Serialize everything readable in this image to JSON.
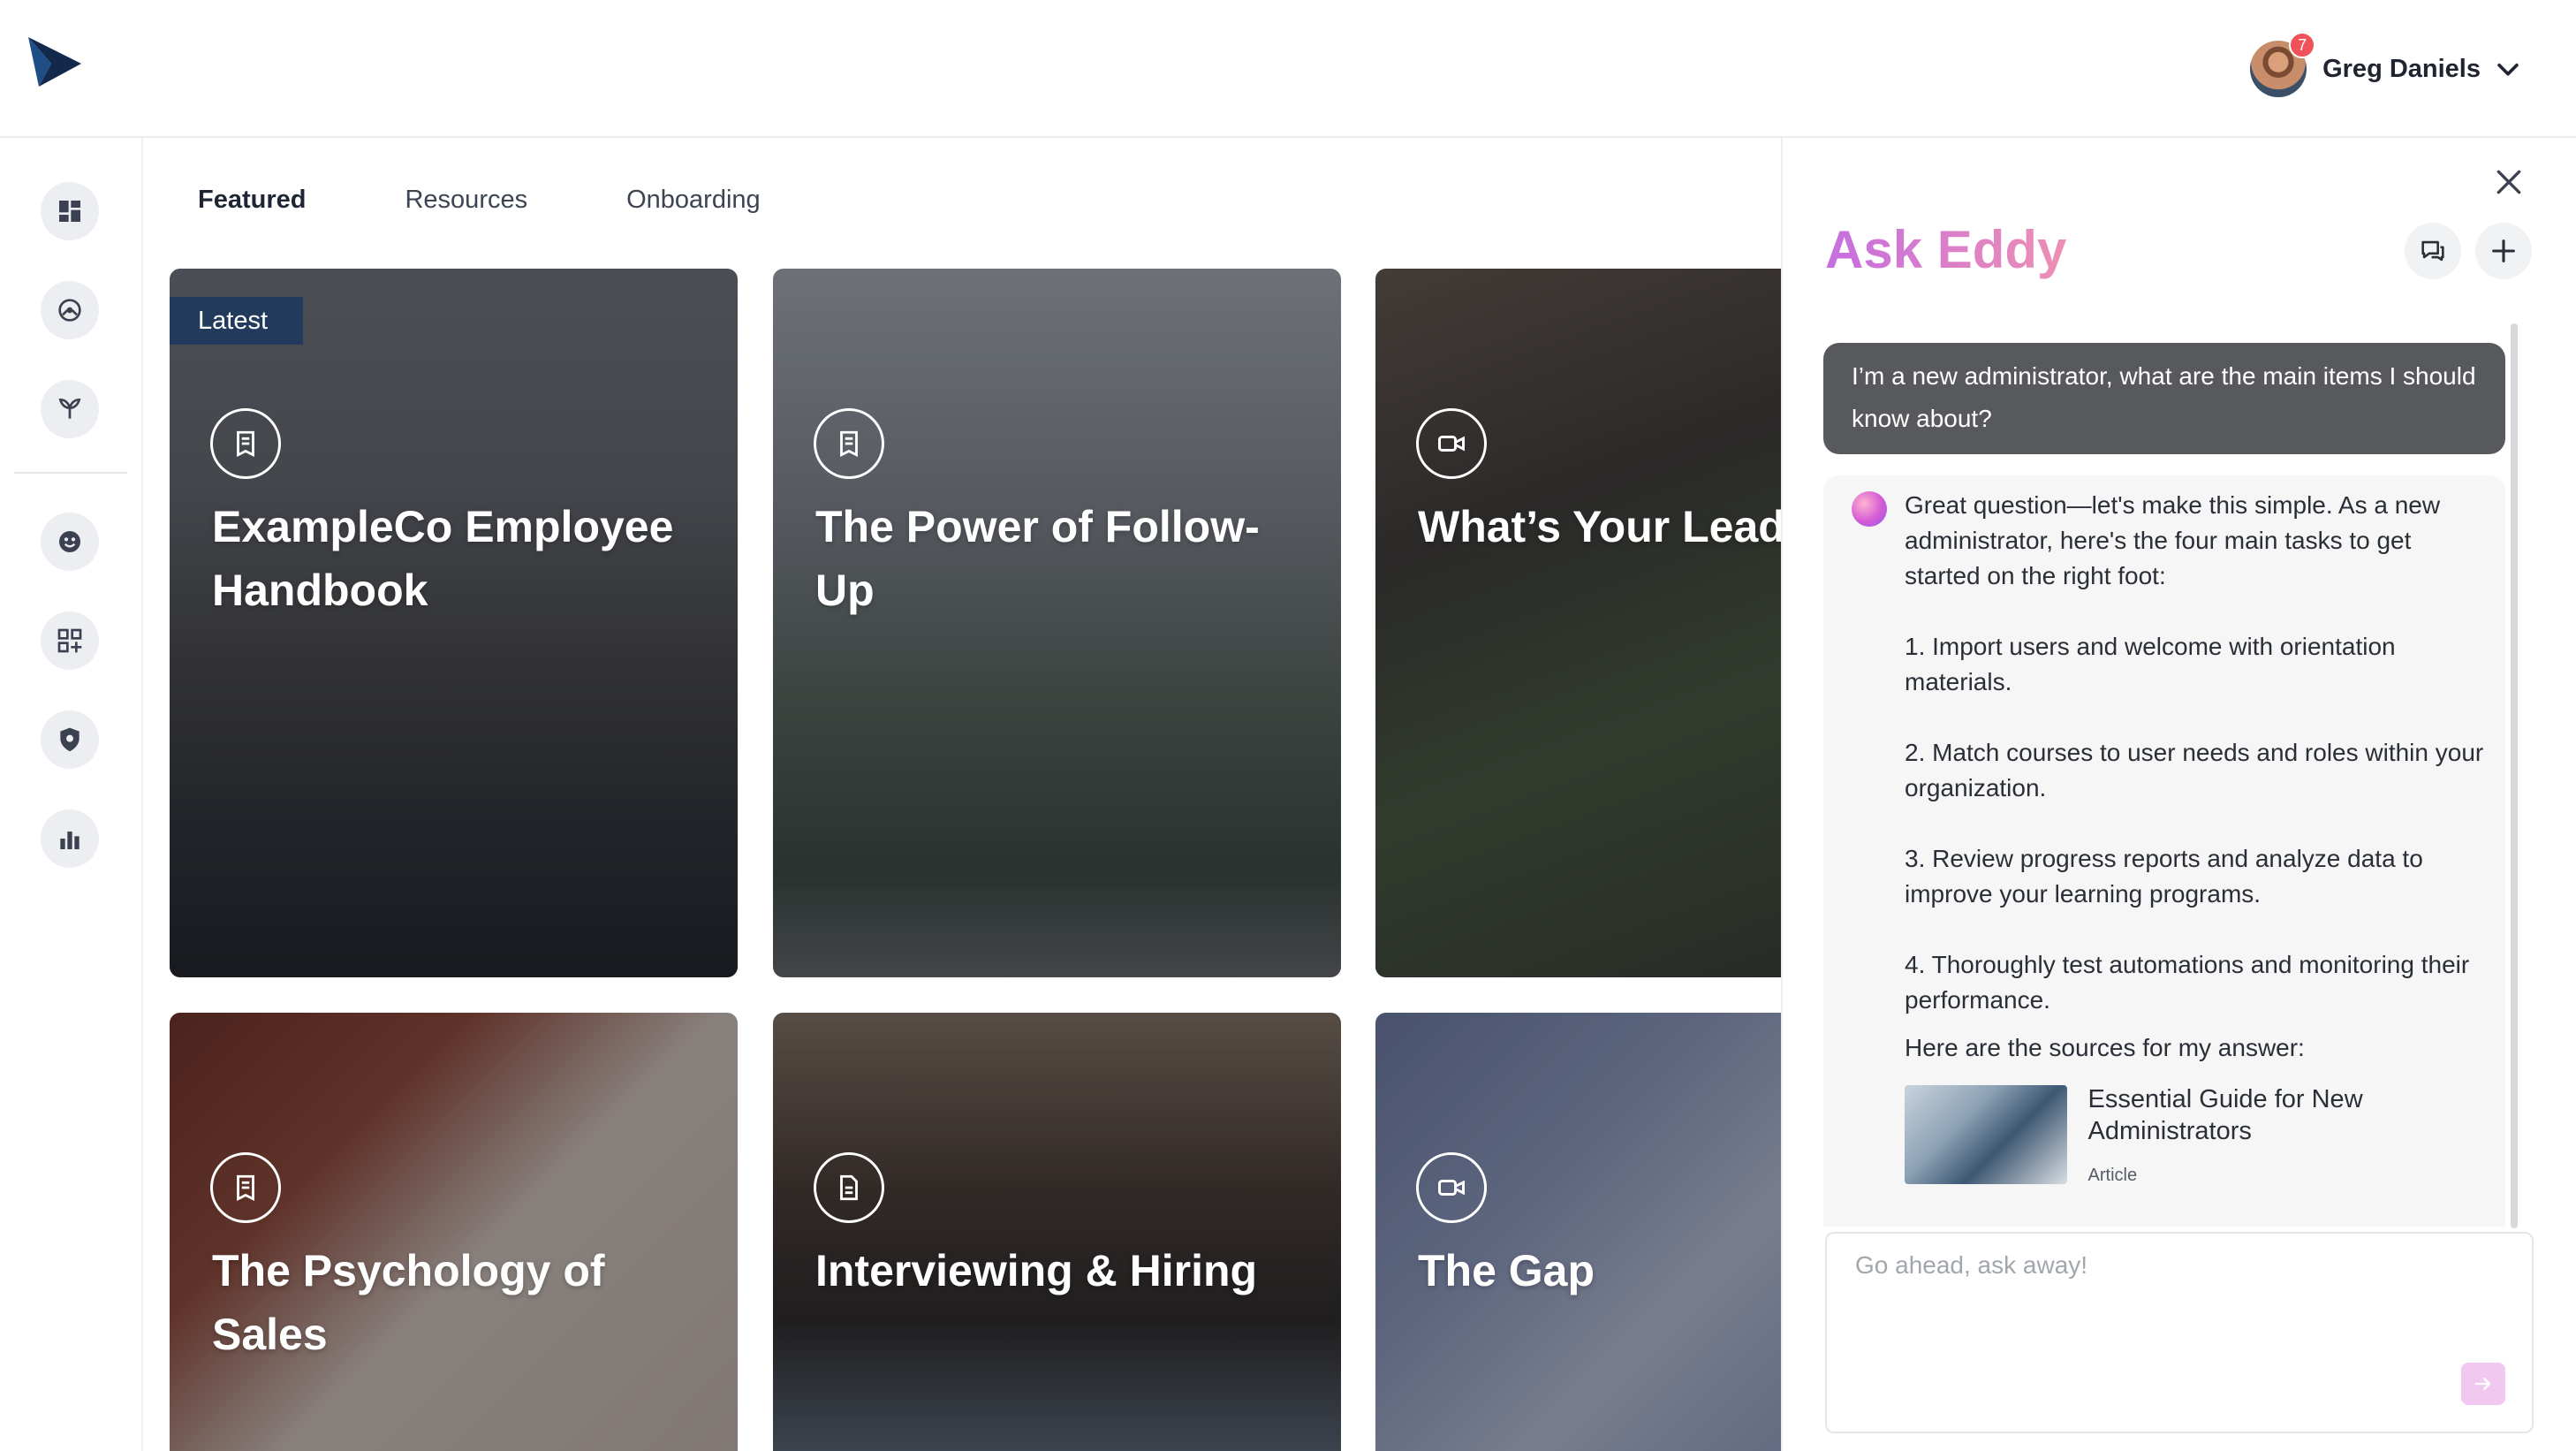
{
  "header": {
    "user_name": "Greg Daniels",
    "notification_count": "7"
  },
  "tabs": [
    {
      "label": "Featured",
      "active": true
    },
    {
      "label": "Resources",
      "active": false
    },
    {
      "label": "Onboarding",
      "active": false
    }
  ],
  "sidebar": {
    "items": [
      {
        "icon": "dashboard-icon"
      },
      {
        "icon": "compass-icon"
      },
      {
        "icon": "sprout-icon"
      },
      {
        "icon": "smiley-icon"
      },
      {
        "icon": "apps-add-icon"
      },
      {
        "icon": "shield-icon"
      },
      {
        "icon": "bar-chart-icon"
      }
    ]
  },
  "cards": [
    {
      "title": "ExampleCo Employee Handbook",
      "badge": "Latest",
      "icon": "document-icon"
    },
    {
      "title": "The Power of Follow-Up",
      "icon": "document-icon"
    },
    {
      "title": "What’s Your Leadership Langu",
      "icon": "video-icon"
    },
    {
      "title": "The Psychology of Sales",
      "icon": "document-icon"
    },
    {
      "title": "Interviewing & Hiring",
      "icon": "file-icon"
    },
    {
      "title": "The Gap",
      "icon": "video-icon"
    }
  ],
  "chat": {
    "title": "Ask Eddy",
    "user_message": "I’m a new administrator, what are the main items I should know about?",
    "bot_intro": "Great question—let's make this simple. As a new administrator, here's the four main tasks to get started on the right foot:",
    "bot_items": [
      "1. Import users and welcome with orientation materials.",
      "2. Match courses to user needs and roles within your organization.",
      "3. Review progress reports and analyze data to improve your learning programs.",
      "4. Thoroughly test automations and monitoring their performance."
    ],
    "sources_label": "Here are the sources for my answer:",
    "source": {
      "title": "Essential Guide for New Administrators",
      "type": "Article"
    },
    "input_placeholder": "Go ahead, ask away!"
  },
  "colors": {
    "accent_gradient_start": "#c56ee0",
    "accent_gradient_end": "#ee8fb3",
    "user_bubble": "#58595c",
    "badge": "#f0525a"
  }
}
